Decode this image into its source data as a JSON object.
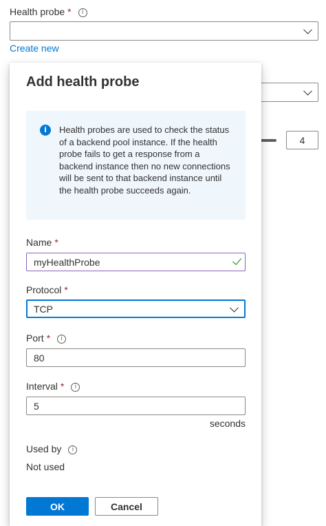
{
  "background": {
    "health_probe_label": "Health probe",
    "required_mark": "*",
    "info_glyph": "i",
    "create_new_link": "Create new",
    "threshold_value": "4"
  },
  "panel": {
    "title": "Add health probe",
    "info_message": "Health probes are used to check the status of a backend pool instance. If the health probe fails to get a response from a backend instance then no new connections will be sent to that backend instance until the health probe succeeds again.",
    "name": {
      "label": "Name",
      "value": "myHealthProbe"
    },
    "protocol": {
      "label": "Protocol",
      "value": "TCP"
    },
    "port": {
      "label": "Port",
      "value": "80"
    },
    "interval": {
      "label": "Interval",
      "value": "5",
      "unit": "seconds"
    },
    "used_by": {
      "label": "Used by",
      "value": "Not used"
    },
    "ok_label": "OK",
    "cancel_label": "Cancel"
  },
  "colors": {
    "accent": "#0078d4",
    "required": "#a4262c",
    "valid_check": "#107c10",
    "info_bg": "#eff6fc"
  }
}
